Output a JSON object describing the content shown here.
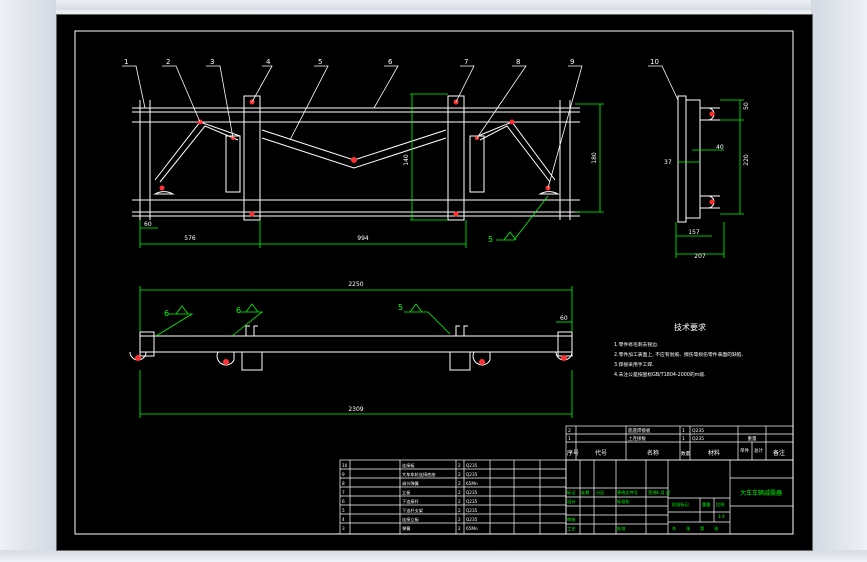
{
  "drawing": {
    "part_numbers": [
      "1",
      "2",
      "3",
      "4",
      "5",
      "6",
      "7",
      "8",
      "9",
      "10"
    ],
    "dims_front": {
      "d_60": "60",
      "d_576": "576",
      "d_994": "994",
      "d_180": "180",
      "d_140": "140"
    },
    "dims_side": {
      "d_50": "50",
      "d_220": "220",
      "d_40": "40",
      "d_37": "37",
      "d_157": "157",
      "d_207": "207"
    },
    "dims_plan": {
      "d_2250": "2250",
      "d_2309": "2309",
      "d_60b": "60"
    },
    "weld_marks": {
      "w5_front": "5",
      "w6_a": "6",
      "w6_b": "6",
      "w5_plan": "5"
    }
  },
  "tech_notes": {
    "heading": "技术要求",
    "items": [
      "1.零件修毛刺去锐边.",
      "2.零件加工表面上, 不应有划痕、擦伤等损伤零件表面的缺陷.",
      "3.焊接采用手工焊.",
      "4.未注公差按国标GB/T1804-2000的m级."
    ]
  },
  "bom_top": {
    "rows": [
      {
        "no": "2",
        "name": "底座焊接板",
        "qty": "1",
        "mat": "Q235"
      },
      {
        "no": "1",
        "name": "上连接板",
        "qty": "1",
        "mat": "Q235"
      }
    ],
    "header": {
      "seq": "序号",
      "code": "代号",
      "name": "名称",
      "qty": "数量",
      "material": "材料",
      "weight": "重量",
      "single": "单件",
      "total": "总计",
      "remark": "备注"
    }
  },
  "bom_left": {
    "rows": [
      {
        "no": "10",
        "name": "连接板",
        "qty": "2",
        "mat": "Q235"
      },
      {
        "no": "9",
        "name": "大车车轮连接底座",
        "qty": "2",
        "mat": "Q235"
      },
      {
        "no": "8",
        "name": "调节弹簧",
        "qty": "2",
        "mat": "65Mn"
      },
      {
        "no": "7",
        "name": "立板",
        "qty": "2",
        "mat": "Q235"
      },
      {
        "no": "6",
        "name": "下连接杆",
        "qty": "2",
        "mat": "Q235"
      },
      {
        "no": "5",
        "name": "下连杆支架",
        "qty": "2",
        "mat": "Q235"
      },
      {
        "no": "4",
        "name": "连接立板",
        "qty": "2",
        "mat": "Q235"
      },
      {
        "no": "3",
        "name": "弹簧",
        "qty": "2",
        "mat": "65Mn"
      }
    ]
  },
  "title_block": {
    "title": "大车车辆减震器",
    "mark": "标记",
    "count": "处数",
    "zone": "分区",
    "change_doc": "更改文件号",
    "sign": "签名",
    "date": "年.月.日",
    "designer": "设计",
    "standard": "标准化",
    "stage_mark": "阶段标记",
    "weight": "重量",
    "scale": "比例",
    "scale_val": "1:4",
    "review": "审核",
    "process": "工艺",
    "approve": "批准",
    "sheets": "共",
    "sheet": "第",
    "sheet_word": "张"
  }
}
